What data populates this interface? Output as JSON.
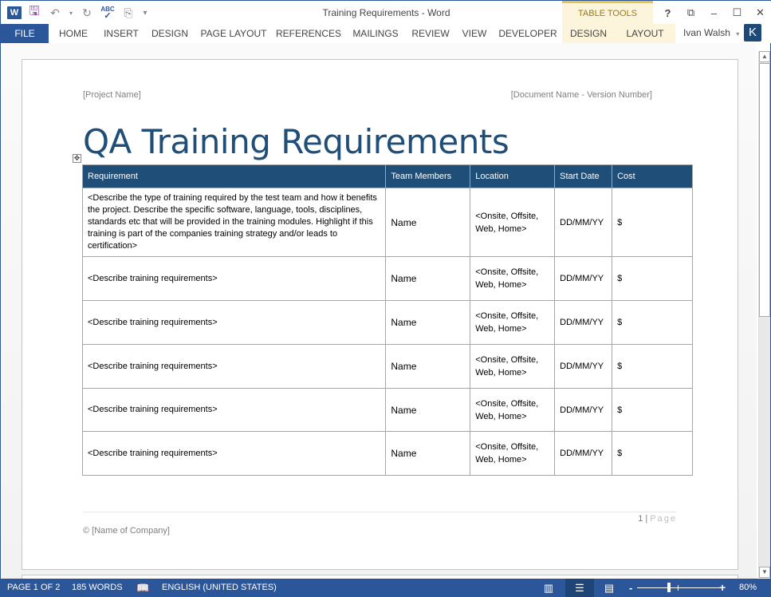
{
  "window": {
    "title": "Training Requirements - Word",
    "context_group": "TABLE TOOLS",
    "user_name": "Ivan Walsh",
    "user_initial": "K",
    "controls": {
      "help": "?",
      "ribbon_display": "⧉",
      "minimize": "–",
      "maximize": "☐",
      "close": "✕"
    }
  },
  "quick_access": [
    {
      "icon": "word-app-icon",
      "glyph": "W"
    },
    {
      "icon": "save-icon",
      "glyph": "🖫"
    },
    {
      "icon": "undo-icon",
      "glyph": "↶"
    },
    {
      "icon": "redo-icon",
      "glyph": "↻"
    },
    {
      "icon": "spelling-check-icon",
      "glyph": "ABC✓"
    },
    {
      "icon": "new-comment-icon",
      "glyph": "⎘"
    },
    {
      "icon": "customize-qat-icon",
      "glyph": "▾"
    }
  ],
  "ribbon": {
    "tabs": [
      "FILE",
      "HOME",
      "INSERT",
      "DESIGN",
      "PAGE LAYOUT",
      "REFERENCES",
      "MAILINGS",
      "REVIEW",
      "VIEW",
      "DEVELOPER"
    ],
    "context_tabs": [
      "DESIGN",
      "LAYOUT"
    ]
  },
  "document": {
    "header_left": "[Project Name]",
    "header_right": "[Document Name - Version Number]",
    "title": "QA Training Requirements",
    "table": {
      "columns": [
        "Requirement",
        "Team Members",
        "Location",
        "Start Date",
        "Cost"
      ],
      "rows": [
        {
          "requirement": "<Describe the type of training required by the test team and how it benefits the project. Describe the specific software, language, tools, disciplines, standards etc that will be provided in the training modules. Highlight if this training is part of the companies training strategy and/or leads to certification>",
          "team": "Name",
          "location_1": "<Onsite, Offsite,",
          "location_2": "Web, Home>",
          "date": "DD/MM/YY",
          "cost": "$"
        },
        {
          "requirement": "<Describe training requirements>",
          "team": "Name",
          "location_1": "<Onsite, Offsite,",
          "location_2": "Web, Home>",
          "date": "DD/MM/YY",
          "cost": "$"
        },
        {
          "requirement": "<Describe training requirements>",
          "team": "Name",
          "location_1": "<Onsite, Offsite,",
          "location_2": "Web, Home>",
          "date": "DD/MM/YY",
          "cost": "$"
        },
        {
          "requirement": "<Describe training requirements>",
          "team": "Name",
          "location_1": "<Onsite, Offsite,",
          "location_2": "Web, Home>",
          "date": "DD/MM/YY",
          "cost": "$"
        },
        {
          "requirement": "<Describe training requirements>",
          "team": "Name",
          "location_1": "<Onsite, Offsite,",
          "location_2": "Web, Home>",
          "date": "DD/MM/YY",
          "cost": "$"
        },
        {
          "requirement": "<Describe training requirements>",
          "team": "Name",
          "location_1": "<Onsite, Offsite,",
          "location_2": "Web, Home>",
          "date": "DD/MM/YY",
          "cost": "$"
        }
      ]
    },
    "footer_page_number": "1",
    "footer_separator": "|",
    "footer_page_label": "Page",
    "footer_company": "© [Name of Company]"
  },
  "status_bar": {
    "page": "PAGE 1 OF 2",
    "words": "185 WORDS",
    "language": "ENGLISH (UNITED STATES)",
    "zoom_minus": "-",
    "zoom_plus": "+",
    "zoom_level": "80%",
    "active_view": "print-layout"
  }
}
